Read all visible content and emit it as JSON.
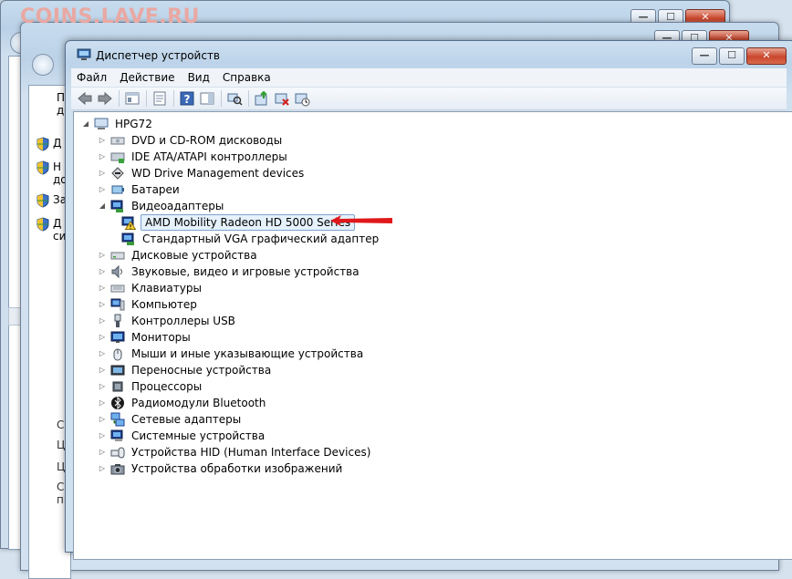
{
  "watermark": "COINS.LAVE.RU",
  "background_windows": {
    "sidebar_items": [
      {
        "text": "П\nдо",
        "icon": "shield-icon"
      },
      {
        "text": "Д",
        "icon": "shield-icon"
      },
      {
        "text": "Н\nдо",
        "icon": "shield-icon"
      },
      {
        "text": "За",
        "icon": "shield-icon"
      },
      {
        "text": "Д\nси",
        "icon": "shield-icon"
      }
    ],
    "lower_fragments": [
      "С",
      "Ц",
      "Ц",
      "С\nпр"
    ]
  },
  "window": {
    "title": "Диспетчер устройств",
    "buttons": {
      "minimize": "—",
      "maximize": "☐",
      "close": "✕"
    }
  },
  "menu": [
    "Файл",
    "Действие",
    "Вид",
    "Справка"
  ],
  "toolbar": [
    "back-icon",
    "forward-icon",
    "show-hide-console-tree-icon",
    "properties-icon",
    "help-icon",
    "action-pane-icon",
    "scan-hardware-icon",
    "update-driver-icon",
    "disable-device-icon",
    "uninstall-device-icon"
  ],
  "tree": {
    "root": "HPG72",
    "items": [
      {
        "label": "DVD и CD-ROM дисководы",
        "icon": "dvd-drive-icon",
        "expanded": false
      },
      {
        "label": "IDE ATA/ATAPI контроллеры",
        "icon": "ide-controller-icon",
        "expanded": false
      },
      {
        "label": "WD Drive Management devices",
        "icon": "wd-device-icon",
        "expanded": false
      },
      {
        "label": "Батареи",
        "icon": "battery-icon",
        "expanded": false
      },
      {
        "label": "Видеоадаптеры",
        "icon": "display-adapter-icon",
        "expanded": true,
        "children": [
          {
            "label": "AMD Mobility Radeon HD 5000 Series",
            "icon": "warning-adapter-icon",
            "selected": true
          },
          {
            "label": "Стандартный VGA графический адаптер",
            "icon": "vga-adapter-icon"
          }
        ]
      },
      {
        "label": "Дисковые устройства",
        "icon": "disk-drive-icon",
        "expanded": false
      },
      {
        "label": "Звуковые, видео и игровые устройства",
        "icon": "sound-icon",
        "expanded": false
      },
      {
        "label": "Клавиатуры",
        "icon": "keyboard-icon",
        "expanded": false
      },
      {
        "label": "Компьютер",
        "icon": "computer-icon",
        "expanded": false
      },
      {
        "label": "Контроллеры USB",
        "icon": "usb-icon",
        "expanded": false
      },
      {
        "label": "Мониторы",
        "icon": "monitor-icon",
        "expanded": false
      },
      {
        "label": "Мыши и иные указывающие устройства",
        "icon": "mouse-icon",
        "expanded": false
      },
      {
        "label": "Переносные устройства",
        "icon": "portable-device-icon",
        "expanded": false
      },
      {
        "label": "Процессоры",
        "icon": "processor-icon",
        "expanded": false
      },
      {
        "label": "Радиомодули Bluetooth",
        "icon": "bluetooth-icon",
        "expanded": false
      },
      {
        "label": "Сетевые адаптеры",
        "icon": "network-adapter-icon",
        "expanded": false
      },
      {
        "label": "Системные устройства",
        "icon": "system-device-icon",
        "expanded": false
      },
      {
        "label": "Устройства HID (Human Interface Devices)",
        "icon": "hid-icon",
        "expanded": false
      },
      {
        "label": "Устройства обработки изображений",
        "icon": "imaging-device-icon",
        "expanded": false
      }
    ]
  },
  "annotation": {
    "color": "#e0181b",
    "icon": "red-arrow-icon"
  }
}
